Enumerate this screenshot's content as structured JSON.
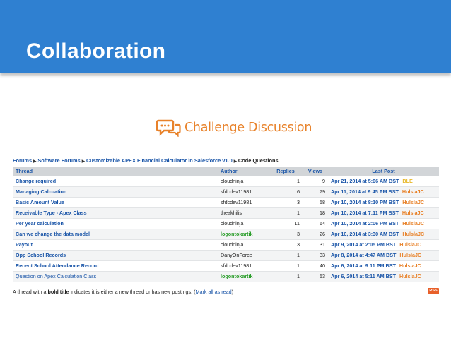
{
  "slide": {
    "title": "Collaboration"
  },
  "challenge": {
    "title": "Challenge Discussion",
    "tiny_mark": "."
  },
  "breadcrumb": {
    "items": [
      "Forums",
      "Software Forums",
      "Customizable APEX Financial Calculator in Salesforce v1.0",
      "Code Questions"
    ]
  },
  "table": {
    "headers": {
      "thread": "Thread",
      "author": "Author",
      "replies": "Replies",
      "views": "Views",
      "last_post": "Last Post"
    },
    "rows": [
      {
        "thread": "Change required",
        "author": "cloudninja",
        "replies": "1",
        "views": "9",
        "date": "Apr 21, 2014 at 5:06 AM BST",
        "user": "BLE"
      },
      {
        "thread": "Managing Calcuation",
        "author": "sfdcdev11981",
        "replies": "6",
        "views": "79",
        "date": "Apr 11, 2014 at 9:45 PM BST",
        "user": "HulslaJC"
      },
      {
        "thread": "Basic Amount Value",
        "author": "sfdcdev11981",
        "replies": "3",
        "views": "58",
        "date": "Apr 10, 2014 at 8:10 PM BST",
        "user": "HulslaJC"
      },
      {
        "thread": "Receivable Type - Apex Class",
        "author": "theakhilis",
        "replies": "1",
        "views": "18",
        "date": "Apr 10, 2014 at 7:11 PM BST",
        "user": "HulslaJC"
      },
      {
        "thread": "Per year calculation",
        "author": "cloudninja",
        "replies": "11",
        "views": "64",
        "date": "Apr 10, 2014 at 2:06 PM BST",
        "user": "HulslaJC"
      },
      {
        "thread": "Can we change the data model",
        "author": "logontokartik",
        "replies": "3",
        "views": "26",
        "date": "Apr 10, 2014 at 3:30 AM BST",
        "user": "HulslaJC"
      },
      {
        "thread": "Payout",
        "author": "cloudninja",
        "replies": "3",
        "views": "31",
        "date": "Apr 9, 2014 at 2:05 PM BST",
        "user": "HulslaJC"
      },
      {
        "thread": "Opp School Records",
        "author": "DanyOnForce",
        "replies": "1",
        "views": "33",
        "date": "Apr 8, 2014 at 4:47 AM BST",
        "user": "HulslaJC"
      },
      {
        "thread": "Recent School Attendance Record",
        "author": "sfdcdev11981",
        "replies": "1",
        "views": "40",
        "date": "Apr 6, 2014 at 9:11 PM BST",
        "user": "HulslaJC"
      },
      {
        "thread": "Question on Apex Calculation Class",
        "author": "logontokartik",
        "replies": "1",
        "views": "53",
        "date": "Apr 6, 2014 at 5:11 AM BST",
        "user": "HulslaJC"
      }
    ]
  },
  "footer": {
    "text_before": "A thread with a ",
    "bold": "bold title",
    "text_after": " indicates it is either a new thread or has new postings. (",
    "link": "Mark all as read",
    "text_end": ")"
  },
  "rss": {
    "label": "RSS"
  },
  "colors": {
    "header_band": "#2f80d1",
    "link": "#1a55a8",
    "accent_orange": "#e8822a",
    "author_green": "#2a9d2a"
  }
}
